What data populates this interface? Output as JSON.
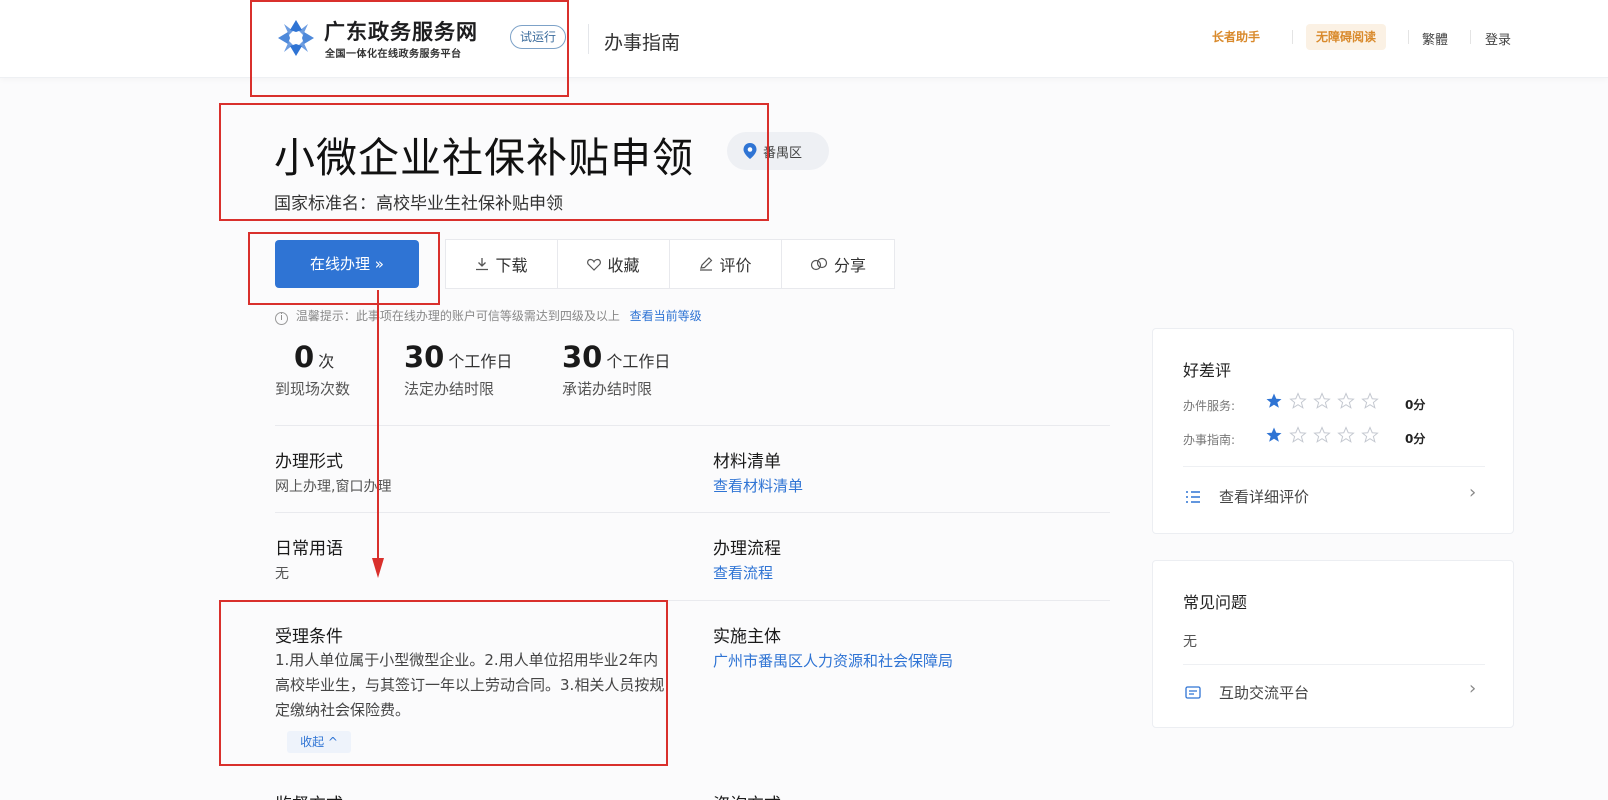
{
  "header": {
    "site_title": "广东政务服务网",
    "site_subtitle": "全国一体化在线政务服务平台",
    "trial_badge": "试运行",
    "nav_guide": "办事指南",
    "elder_mode": "长者助手",
    "accessible_reading": "无障碍阅读",
    "traditional": "繁體",
    "login": "登录"
  },
  "title_block": {
    "title": "小微企业社保补贴申领",
    "location": "番禺区",
    "standard_name": "国家标准名：高校毕业生社保补贴申领"
  },
  "actions": {
    "online": "在线办理 »",
    "download": "下载",
    "favorite": "收藏",
    "evaluate": "评价",
    "share": "分享"
  },
  "tip": {
    "text": "温馨提示：此事项在线办理的账户可信等级需达到四级及以上",
    "link": "查看当前等级"
  },
  "stats": [
    {
      "value": "0",
      "unit": "次",
      "label": "到现场次数"
    },
    {
      "value": "30",
      "unit": "个工作日",
      "label": "法定办结时限"
    },
    {
      "value": "30",
      "unit": "个工作日",
      "label": "承诺办结时限"
    }
  ],
  "fields": {
    "handle_form_label": "办理形式",
    "handle_form_value": "网上办理,窗口办理",
    "materials_label": "材料清单",
    "materials_link": "查看材料清单",
    "common_terms_label": "日常用语",
    "common_terms_value": "无",
    "process_label": "办理流程",
    "process_link": "查看流程",
    "conditions_label": "受理条件",
    "conditions_text": "1.用人单位属于小型微型企业。2.用人单位招用毕业2年内高校毕业生，与其签订一年以上劳动合同。3.相关人员按规定缴纳社会保险费。",
    "collapse": "收起 ^",
    "implementer_label": "实施主体",
    "implementer_link": "广州市番禺区人力资源和社会保障局",
    "supervision_label": "监督方式",
    "consult_label": "咨询方式"
  },
  "ratings_card": {
    "title": "好差评",
    "rows": [
      {
        "label": "办件服务:",
        "score": "0分",
        "stars": 1
      },
      {
        "label": "办事指南:",
        "score": "0分",
        "stars": 1
      }
    ],
    "detail_link": "查看详细评价"
  },
  "faq_card": {
    "title": "常见问题",
    "value": "无",
    "platform_link": "互助交流平台"
  },
  "colors": {
    "primary": "#2f74d4",
    "annotation": "#d9302c",
    "star_filled": "#2f74d4",
    "accent_orange": "#d98a2c"
  }
}
